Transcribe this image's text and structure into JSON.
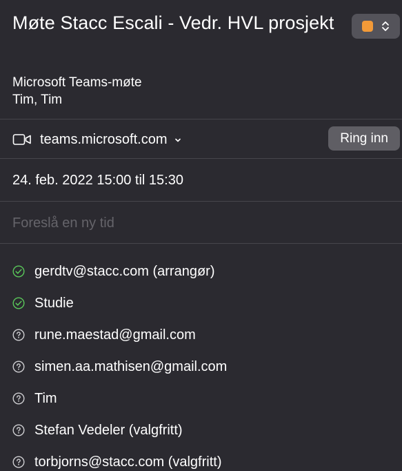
{
  "event": {
    "title": "Møte Stacc Escali - Vedr. HVL prosjekt",
    "calendar_color": "#f29a38",
    "meeting_type": "Microsoft Teams-møte",
    "organizer_line": "Tim, Tim",
    "location": {
      "icon": "video-icon",
      "text": "teams.microsoft.com",
      "chevron_icon": "chevron-down-icon"
    },
    "call_button_label": "Ring inn",
    "datetime": "24. feb. 2022 15:00 til 15:30",
    "suggest_placeholder": "Foreslå en ny tid"
  },
  "attendees": [
    {
      "name": "gerdtv@stacc.com (arrangør)",
      "status": "accepted",
      "icon": "checkmark-circle-icon",
      "icon_color": "#5ac85a"
    },
    {
      "name": "Studie",
      "status": "accepted",
      "icon": "checkmark-circle-icon",
      "icon_color": "#5ac85a"
    },
    {
      "name": "rune.maestad@gmail.com",
      "status": "unknown",
      "icon": "question-circle-icon",
      "icon_color": "#cfcfd2"
    },
    {
      "name": "simen.aa.mathisen@gmail.com",
      "status": "unknown",
      "icon": "question-circle-icon",
      "icon_color": "#cfcfd2"
    },
    {
      "name": "Tim",
      "status": "unknown",
      "icon": "question-circle-icon",
      "icon_color": "#cfcfd2"
    },
    {
      "name": "Stefan Vedeler (valgfritt)",
      "status": "unknown",
      "icon": "question-circle-icon",
      "icon_color": "#cfcfd2"
    },
    {
      "name": "torbjorns@stacc.com (valgfritt)",
      "status": "unknown",
      "icon": "question-circle-icon",
      "icon_color": "#cfcfd2"
    }
  ]
}
